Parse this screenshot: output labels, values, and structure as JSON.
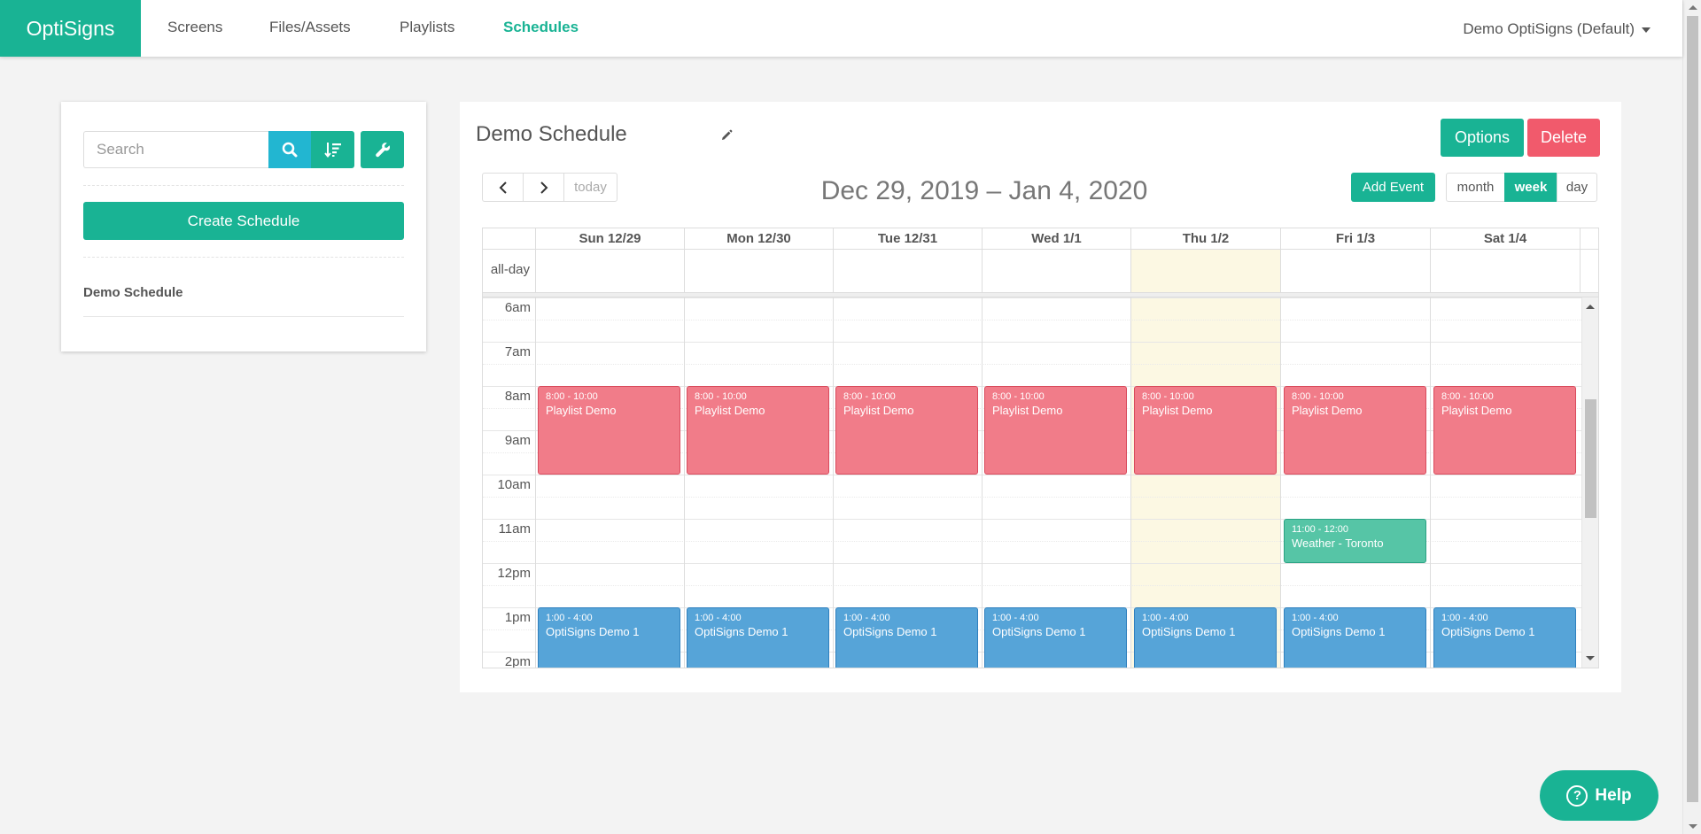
{
  "brand": "OptiSigns",
  "nav": {
    "items": [
      {
        "label": "Screens"
      },
      {
        "label": "Files/Assets"
      },
      {
        "label": "Playlists"
      },
      {
        "label": "Schedules",
        "active": true
      }
    ],
    "account": "Demo OptiSigns (Default)"
  },
  "sidebar": {
    "search_placeholder": "Search",
    "search_icon": "search-icon",
    "sort_icon": "sort-icon",
    "tools_icon": "wrench-icon",
    "create_label": "Create Schedule",
    "schedules": [
      {
        "name": "Demo Schedule"
      }
    ]
  },
  "main": {
    "title": "Demo Schedule",
    "edit_icon": "pencil-icon",
    "options_label": "Options",
    "delete_label": "Delete",
    "add_event_label": "Add Event",
    "today_label": "today",
    "range": "Dec 29, 2019 – Jan 4, 2020",
    "views": [
      "month",
      "week",
      "day"
    ],
    "active_view": "week"
  },
  "calendar": {
    "allday_label": "all-day",
    "days": [
      "Sun 12/29",
      "Mon 12/30",
      "Tue 12/31",
      "Wed 1/1",
      "Thu 1/2",
      "Fri 1/3",
      "Sat 1/4"
    ],
    "today_index": 4,
    "hours": [
      "6am",
      "7am",
      "8am",
      "9am",
      "10am",
      "11am",
      "12pm",
      "1pm",
      "2pm"
    ],
    "events": [
      {
        "day": 0,
        "time": "8:00 - 10:00",
        "title": "Playlist Demo",
        "color": "red"
      },
      {
        "day": 1,
        "time": "8:00 - 10:00",
        "title": "Playlist Demo",
        "color": "red"
      },
      {
        "day": 2,
        "time": "8:00 - 10:00",
        "title": "Playlist Demo",
        "color": "red"
      },
      {
        "day": 3,
        "time": "8:00 - 10:00",
        "title": "Playlist Demo",
        "color": "red"
      },
      {
        "day": 4,
        "time": "8:00 - 10:00",
        "title": "Playlist Demo",
        "color": "red"
      },
      {
        "day": 5,
        "time": "8:00 - 10:00",
        "title": "Playlist Demo",
        "color": "red"
      },
      {
        "day": 6,
        "time": "8:00 - 10:00",
        "title": "Playlist Demo",
        "color": "red"
      },
      {
        "day": 5,
        "time": "11:00 - 12:00",
        "title": "Weather - Toronto",
        "color": "green"
      },
      {
        "day": 0,
        "time": "1:00 - 4:00",
        "title": "OptiSigns Demo 1",
        "color": "blue"
      },
      {
        "day": 1,
        "time": "1:00 - 4:00",
        "title": "OptiSigns Demo 1",
        "color": "blue"
      },
      {
        "day": 2,
        "time": "1:00 - 4:00",
        "title": "OptiSigns Demo 1",
        "color": "blue"
      },
      {
        "day": 3,
        "time": "1:00 - 4:00",
        "title": "OptiSigns Demo 1",
        "color": "blue"
      },
      {
        "day": 4,
        "time": "1:00 - 4:00",
        "title": "OptiSigns Demo 1",
        "color": "blue"
      },
      {
        "day": 5,
        "time": "1:00 - 4:00",
        "title": "OptiSigns Demo 1",
        "color": "blue"
      },
      {
        "day": 6,
        "time": "1:00 - 4:00",
        "title": "OptiSigns Demo 1",
        "color": "blue"
      }
    ]
  },
  "help": {
    "label": "Help",
    "icon": "help-circle-icon"
  },
  "colors": {
    "brand": "#19b394",
    "search": "#22b6d1",
    "delete": "#f15a6c",
    "today_bg": "#fcf8e3",
    "event_red": "#f17c89",
    "event_green": "#56c5a6",
    "event_blue": "#56a4d8"
  }
}
